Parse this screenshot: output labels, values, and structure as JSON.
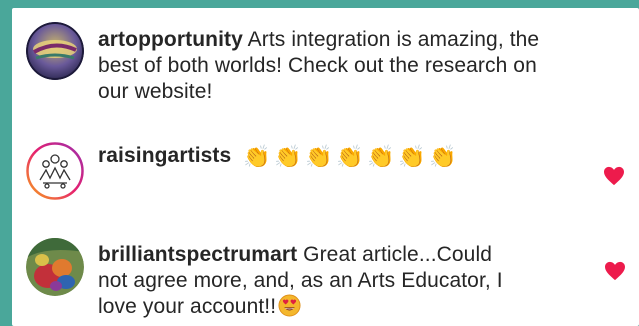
{
  "colors": {
    "frame": "#4aa79a",
    "text": "#262626",
    "heart": "#ed1b4c",
    "clap": "#f0b323"
  },
  "comments": [
    {
      "username": "artopportunity",
      "text_lines": [
        "Arts integration is amazing, the",
        "best of both worlds! Check out the research on",
        "our website!"
      ],
      "avatar_icon": "artopportunity-logo-icon",
      "liked": false
    },
    {
      "username": "raisingartists",
      "emoji": [
        "👏",
        "👏",
        "👏",
        "👏",
        "👏",
        "👏",
        "👏"
      ],
      "avatar_icon": "raisingartists-logo-icon",
      "liked": true,
      "like_icon": "heart-icon"
    },
    {
      "username": "brilliantspectrumart",
      "text_lines": [
        "Great article...Could",
        "not agree more, and, as an Arts Educator, I",
        "love your account!!"
      ],
      "trailing_emoji": "heart-eyes-face-icon",
      "avatar_icon": "brilliantspectrumart-photo-icon",
      "liked": true,
      "like_icon": "heart-icon"
    }
  ]
}
